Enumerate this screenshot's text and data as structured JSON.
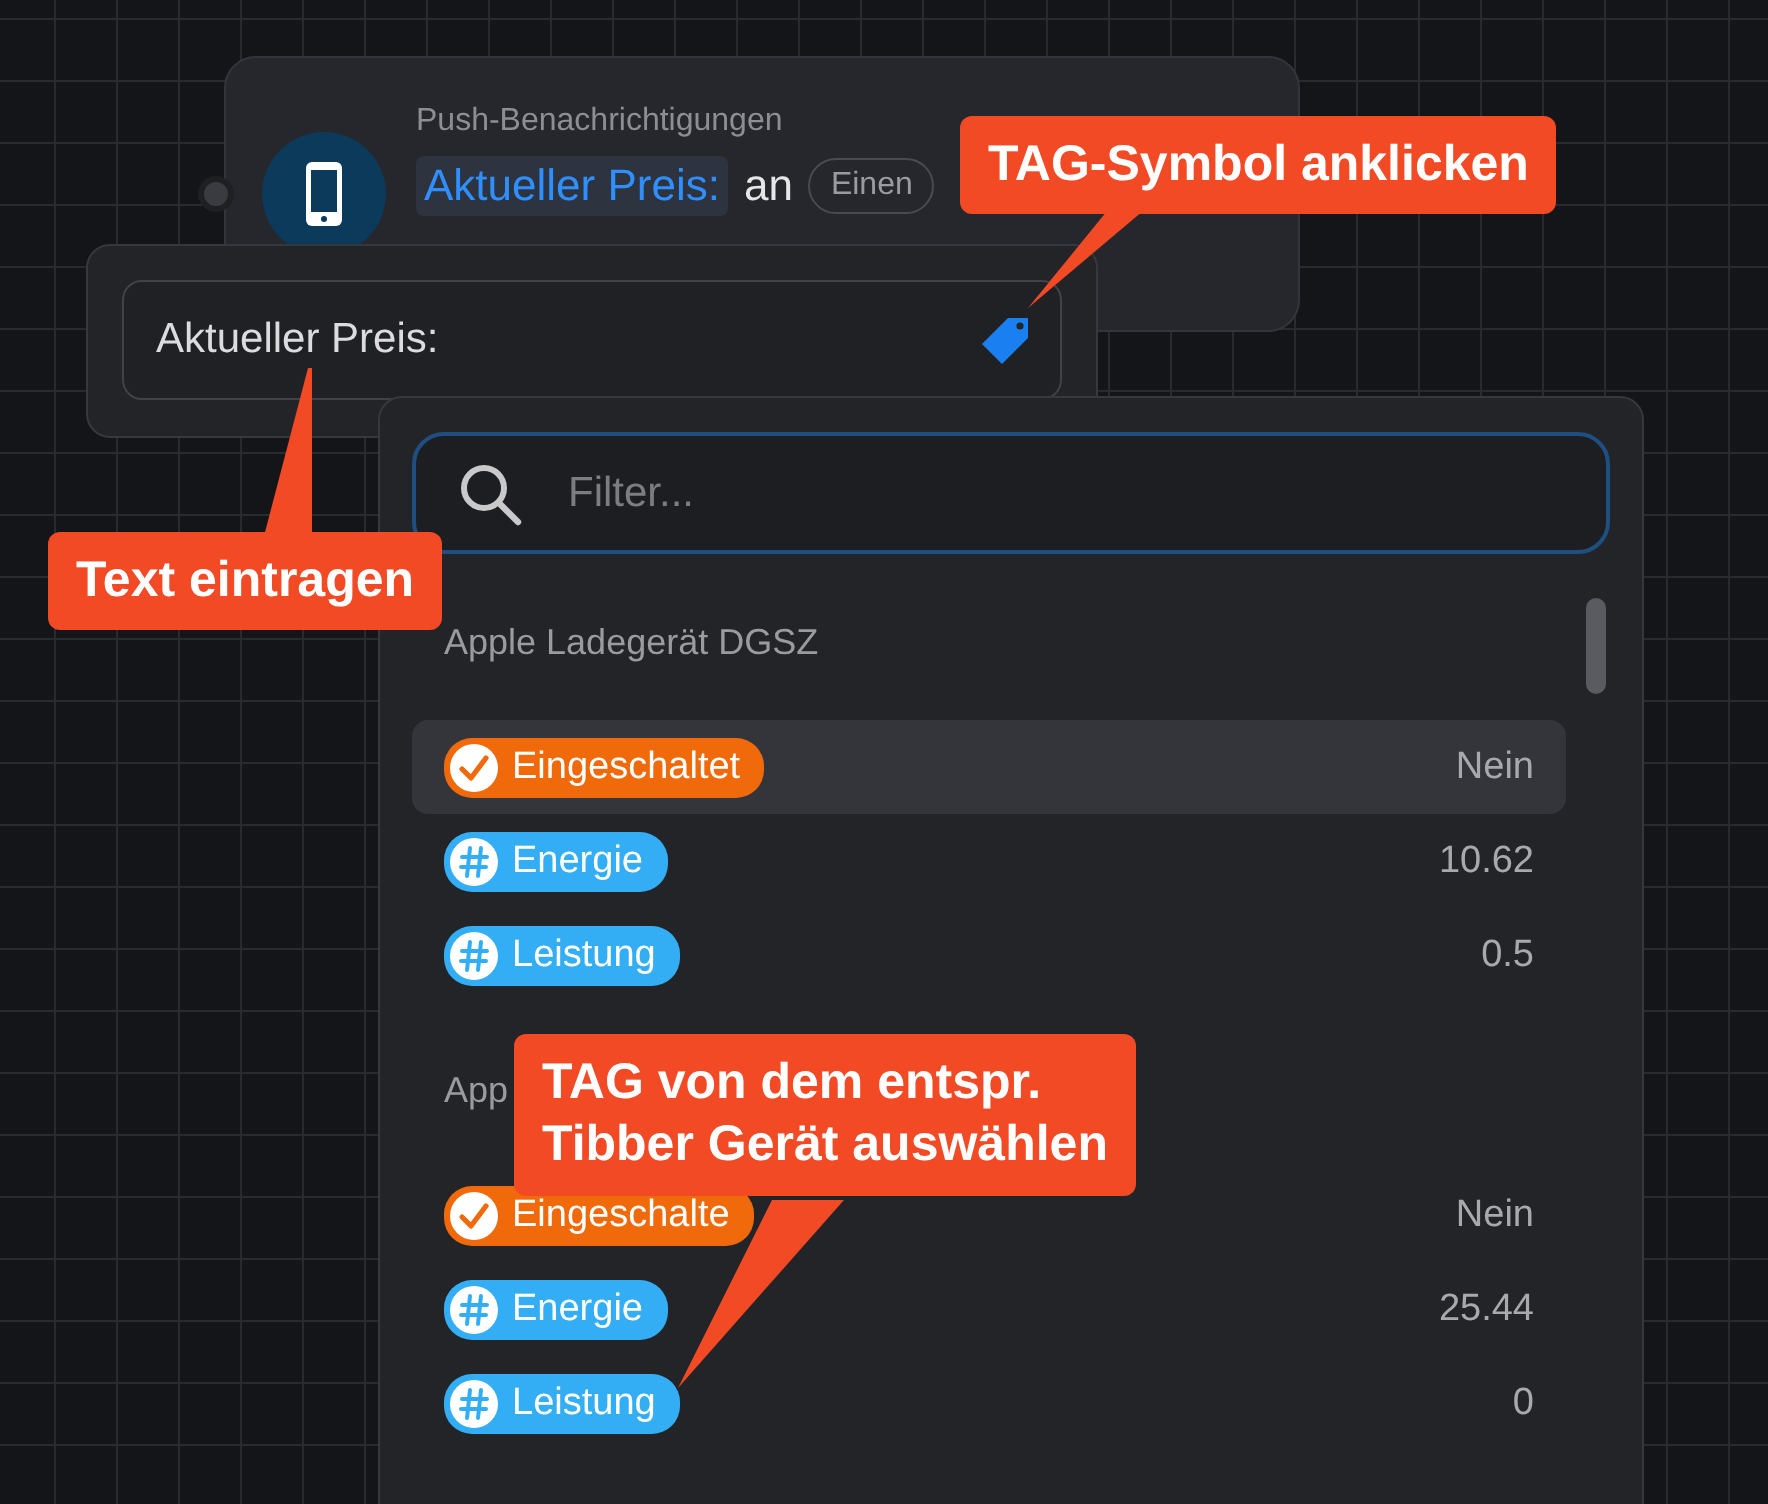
{
  "node": {
    "title": "Push-Benachrichtigungen",
    "tag": "Aktueller Preis:",
    "text": "an",
    "chip": "Einen"
  },
  "input": {
    "value": "Aktueller Preis:"
  },
  "dropdown": {
    "placeholder": "Filter...",
    "groups": [
      {
        "heading": "Apple Ladegerät DGSZ",
        "rows": [
          {
            "kind": "switch",
            "label": "Eingeschaltet",
            "value": "Nein",
            "selected": true
          },
          {
            "kind": "number",
            "label": "Energie",
            "value": "10.62",
            "selected": false
          },
          {
            "kind": "number",
            "label": "Leistung",
            "value": "0.5",
            "selected": false
          }
        ]
      },
      {
        "heading": "App",
        "rows": [
          {
            "kind": "switch",
            "label": "Eingeschalte",
            "value": "Nein",
            "selected": false
          },
          {
            "kind": "number",
            "label": "Energie",
            "value": "25.44",
            "selected": false
          },
          {
            "kind": "number",
            "label": "Leistung",
            "value": "0",
            "selected": false
          }
        ]
      }
    ]
  },
  "callouts": [
    {
      "text": "TAG-Symbol anklicken"
    },
    {
      "text": "Text eintragen"
    },
    {
      "text": "TAG von dem entspr.\nTibber Gerät auswählen"
    }
  ]
}
